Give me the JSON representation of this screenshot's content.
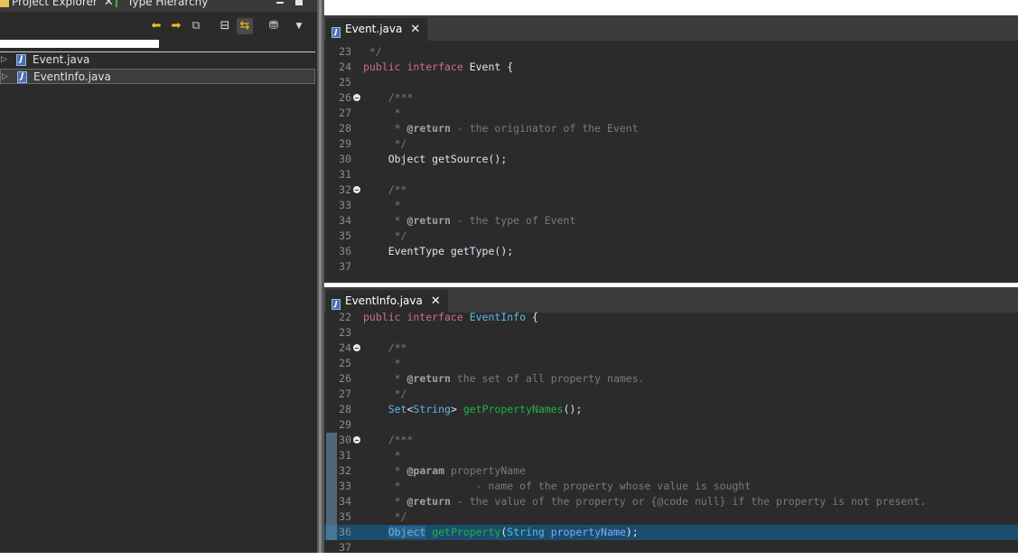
{
  "left_panel": {
    "tabs": [
      {
        "label": "Project Explorer",
        "close": "✕"
      },
      {
        "label": "Type Hierarchy"
      }
    ],
    "tree": [
      {
        "label": "Event.java"
      },
      {
        "label": "EventInfo.java"
      }
    ]
  },
  "editors": [
    {
      "tab_label": "Event.java",
      "close": "✕",
      "lines": [
        {
          "n": "23",
          "segs": [
            [
              "cm",
              " */"
            ]
          ]
        },
        {
          "n": "24",
          "segs": [
            [
              "kw",
              "public interface "
            ],
            [
              "white",
              "Event {"
            ]
          ]
        },
        {
          "n": "25",
          "segs": []
        },
        {
          "n": "26",
          "fold": true,
          "segs": [
            [
              "cm",
              "    /***"
            ]
          ]
        },
        {
          "n": "27",
          "segs": [
            [
              "cm",
              "     *"
            ]
          ]
        },
        {
          "n": "28",
          "segs": [
            [
              "cm",
              "     * "
            ],
            [
              "ann",
              "@return"
            ],
            [
              "cm",
              " - the originator of the Event"
            ]
          ]
        },
        {
          "n": "29",
          "segs": [
            [
              "cm",
              "     */"
            ]
          ]
        },
        {
          "n": "30",
          "segs": [
            [
              "white",
              "    Object getSource();"
            ]
          ]
        },
        {
          "n": "31",
          "segs": []
        },
        {
          "n": "32",
          "fold": true,
          "segs": [
            [
              "cm",
              "    /**"
            ]
          ]
        },
        {
          "n": "33",
          "segs": [
            [
              "cm",
              "     *"
            ]
          ]
        },
        {
          "n": "34",
          "segs": [
            [
              "cm",
              "     * "
            ],
            [
              "ann",
              "@return"
            ],
            [
              "cm",
              " - the type of Event"
            ]
          ]
        },
        {
          "n": "35",
          "segs": [
            [
              "cm",
              "     */"
            ]
          ]
        },
        {
          "n": "36",
          "segs": [
            [
              "white",
              "    EventType getType();"
            ]
          ]
        },
        {
          "n": "37",
          "segs": []
        }
      ]
    },
    {
      "tab_label": "EventInfo.java",
      "close": "✕",
      "lines": [
        {
          "n": "22",
          "segs": [
            [
              "kw",
              "public interface "
            ],
            [
              "tp",
              "EventInfo"
            ],
            [
              "white",
              " {"
            ]
          ]
        },
        {
          "n": "23",
          "segs": []
        },
        {
          "n": "24",
          "fold": true,
          "segs": [
            [
              "cm",
              "    /**"
            ]
          ]
        },
        {
          "n": "25",
          "segs": [
            [
              "cm",
              "     *"
            ]
          ]
        },
        {
          "n": "26",
          "segs": [
            [
              "cm",
              "     * "
            ],
            [
              "ann",
              "@return"
            ],
            [
              "cm",
              " the set of all property names."
            ]
          ]
        },
        {
          "n": "27",
          "segs": [
            [
              "cm",
              "     */"
            ]
          ]
        },
        {
          "n": "28",
          "segs": [
            [
              "tp",
              "    Set"
            ],
            [
              "white",
              "<"
            ],
            [
              "tp",
              "String"
            ],
            [
              "white",
              "> "
            ],
            [
              "fn",
              "getPropertyNames"
            ],
            [
              "white",
              "();"
            ]
          ]
        },
        {
          "n": "29",
          "segs": []
        },
        {
          "n": "30",
          "fold": true,
          "mark": true,
          "segs": [
            [
              "cm",
              "    /***"
            ]
          ]
        },
        {
          "n": "31",
          "mark": true,
          "segs": [
            [
              "cm",
              "     *"
            ]
          ]
        },
        {
          "n": "32",
          "mark": true,
          "segs": [
            [
              "cm",
              "     * "
            ],
            [
              "ann",
              "@param"
            ],
            [
              "cm",
              " propertyName"
            ]
          ]
        },
        {
          "n": "33",
          "mark": true,
          "segs": [
            [
              "cm",
              "     *            - name of the property whose value is sought"
            ]
          ]
        },
        {
          "n": "34",
          "mark": true,
          "segs": [
            [
              "cm",
              "     * "
            ],
            [
              "ann",
              "@return"
            ],
            [
              "cm",
              " - the value of the property or {@code null} if the property is not present."
            ]
          ]
        },
        {
          "n": "35",
          "mark": true,
          "segs": [
            [
              "cm",
              "     */"
            ]
          ]
        },
        {
          "n": "36",
          "mark": true,
          "hl": true,
          "segs": [
            [
              "white",
              "    "
            ],
            [
              "sel",
              "Object"
            ],
            [
              "white",
              " "
            ],
            [
              "fn",
              "getProperty"
            ],
            [
              "white",
              "("
            ],
            [
              "tp",
              "String"
            ],
            [
              "white",
              " "
            ],
            [
              "pn",
              "propertyName"
            ],
            [
              "white",
              ");"
            ]
          ]
        },
        {
          "n": "37",
          "segs": []
        }
      ]
    }
  ]
}
